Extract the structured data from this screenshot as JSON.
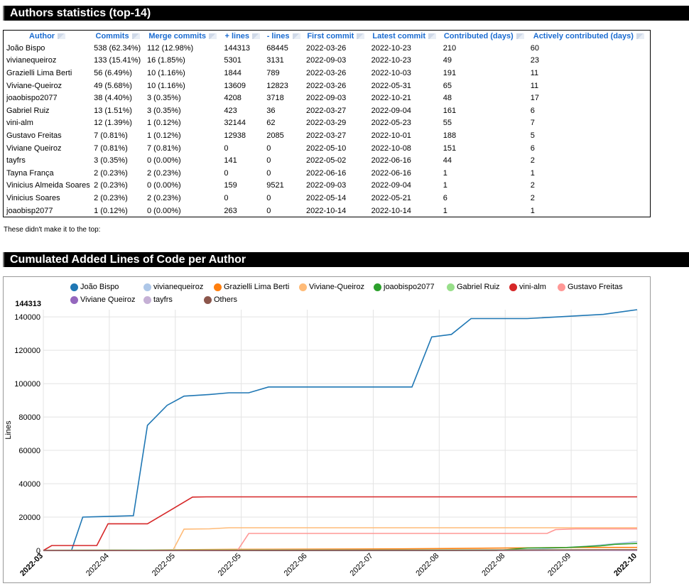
{
  "authors_section": {
    "title": "Authors statistics (top-14)"
  },
  "table": {
    "headers": [
      "Author",
      "Commits",
      "Merge commits",
      "+ lines",
      "- lines",
      "First commit",
      "Latest commit",
      "Contributed (days)",
      "Actively contributed (days)"
    ],
    "rows": [
      [
        "João Bispo",
        "538 (62.34%)",
        "112 (12.98%)",
        "144313",
        "68445",
        "2022-03-26",
        "2022-10-23",
        "210",
        "60"
      ],
      [
        "vivianequeiroz",
        "133 (15.41%)",
        "16 (1.85%)",
        "5301",
        "3131",
        "2022-09-03",
        "2022-10-23",
        "49",
        "23"
      ],
      [
        "Grazielli Lima Berti",
        "56 (6.49%)",
        "10 (1.16%)",
        "1844",
        "789",
        "2022-03-26",
        "2022-10-03",
        "191",
        "11"
      ],
      [
        "Viviane-Queiroz",
        "49 (5.68%)",
        "10 (1.16%)",
        "13609",
        "12823",
        "2022-03-26",
        "2022-05-31",
        "65",
        "11"
      ],
      [
        "joaobispo2077",
        "38 (4.40%)",
        "3 (0.35%)",
        "4208",
        "3718",
        "2022-09-03",
        "2022-10-21",
        "48",
        "17"
      ],
      [
        "Gabriel Ruiz",
        "13 (1.51%)",
        "3 (0.35%)",
        "423",
        "36",
        "2022-03-27",
        "2022-09-04",
        "161",
        "6"
      ],
      [
        "vini-alm",
        "12 (1.39%)",
        "1 (0.12%)",
        "32144",
        "62",
        "2022-03-29",
        "2022-05-23",
        "55",
        "7"
      ],
      [
        "Gustavo Freitas",
        "7 (0.81%)",
        "1 (0.12%)",
        "12938",
        "2085",
        "2022-03-27",
        "2022-10-01",
        "188",
        "5"
      ],
      [
        "Viviane Queiroz",
        "7 (0.81%)",
        "7 (0.81%)",
        "0",
        "0",
        "2022-05-10",
        "2022-10-08",
        "151",
        "6"
      ],
      [
        "tayfrs",
        "3 (0.35%)",
        "0 (0.00%)",
        "141",
        "0",
        "2022-05-02",
        "2022-06-16",
        "44",
        "2"
      ],
      [
        "Tayna França",
        "2 (0.23%)",
        "2 (0.23%)",
        "0",
        "0",
        "2022-06-16",
        "2022-06-16",
        "1",
        "1"
      ],
      [
        "Vinicius Almeida Soares",
        "2 (0.23%)",
        "0 (0.00%)",
        "159",
        "9521",
        "2022-09-03",
        "2022-09-04",
        "1",
        "2"
      ],
      [
        "Vinicius Soares",
        "2 (0.23%)",
        "2 (0.23%)",
        "0",
        "0",
        "2022-05-14",
        "2022-05-21",
        "6",
        "2"
      ],
      [
        "joaobisp2077",
        "1 (0.12%)",
        "0 (0.00%)",
        "263",
        "0",
        "2022-10-14",
        "2022-10-14",
        "1",
        "1"
      ]
    ]
  },
  "note": "These didn't make it to the top:",
  "chart_section": {
    "title": "Cumulated Added Lines of Code per Author"
  },
  "chart_data": {
    "type": "line",
    "title": "",
    "xlabel": "",
    "ylabel": "Lines",
    "ylim": [
      0,
      144313
    ],
    "y_ticks": [
      0,
      20000,
      40000,
      60000,
      80000,
      100000,
      120000,
      140000
    ],
    "y_max_label": "144313",
    "x_ticks": [
      "2022-03",
      "2022-04",
      "2022-05",
      "2022-05",
      "2022-06",
      "2022-07",
      "2022-08",
      "2022-08",
      "2022-09",
      "2022-10"
    ],
    "x_range": [
      "2022-03-26",
      "2022-10-23"
    ],
    "grid": true,
    "legend_position": "top",
    "series": [
      {
        "name": "João Bispo",
        "color": "#1f77b4",
        "points": [
          [
            "2022-03-26",
            0
          ],
          [
            "2022-04-05",
            0
          ],
          [
            "2022-04-09",
            20000
          ],
          [
            "2022-04-20",
            20500
          ],
          [
            "2022-04-27",
            20800
          ],
          [
            "2022-05-02",
            75000
          ],
          [
            "2022-05-09",
            87000
          ],
          [
            "2022-05-15",
            92500
          ],
          [
            "2022-05-24",
            93500
          ],
          [
            "2022-05-31",
            94500
          ],
          [
            "2022-06-07",
            94500
          ],
          [
            "2022-06-14",
            98000
          ],
          [
            "2022-08-04",
            98000
          ],
          [
            "2022-08-11",
            128000
          ],
          [
            "2022-08-18",
            129500
          ],
          [
            "2022-08-25",
            139000
          ],
          [
            "2022-09-14",
            139000
          ],
          [
            "2022-10-11",
            141500
          ],
          [
            "2022-10-23",
            144313
          ]
        ]
      },
      {
        "name": "vivianequeiroz",
        "color": "#aec7e8",
        "points": [
          [
            "2022-03-26",
            0
          ],
          [
            "2022-09-03",
            0
          ],
          [
            "2022-09-18",
            800
          ],
          [
            "2022-10-05",
            2500
          ],
          [
            "2022-10-23",
            5301
          ]
        ]
      },
      {
        "name": "Grazielli Lima Berti",
        "color": "#ff7f0e",
        "points": [
          [
            "2022-03-26",
            0
          ],
          [
            "2022-05-01",
            300
          ],
          [
            "2022-06-01",
            700
          ],
          [
            "2022-08-01",
            1000
          ],
          [
            "2022-09-01",
            1400
          ],
          [
            "2022-10-03",
            1844
          ],
          [
            "2022-10-23",
            1844
          ]
        ]
      },
      {
        "name": "Viviane-Queiroz",
        "color": "#ffbb78",
        "points": [
          [
            "2022-03-26",
            0
          ],
          [
            "2022-05-11",
            0
          ],
          [
            "2022-05-15",
            12800
          ],
          [
            "2022-05-24",
            13000
          ],
          [
            "2022-05-31",
            13609
          ],
          [
            "2022-10-23",
            13609
          ]
        ]
      },
      {
        "name": "joaobispo2077",
        "color": "#2ca02c",
        "points": [
          [
            "2022-03-26",
            0
          ],
          [
            "2022-09-03",
            0
          ],
          [
            "2022-09-14",
            1500
          ],
          [
            "2022-09-28",
            1800
          ],
          [
            "2022-10-10",
            2800
          ],
          [
            "2022-10-15",
            3700
          ],
          [
            "2022-10-23",
            4208
          ]
        ]
      },
      {
        "name": "Gabriel Ruiz",
        "color": "#98df8a",
        "points": [
          [
            "2022-03-26",
            0
          ],
          [
            "2022-03-27",
            200
          ],
          [
            "2022-05-01",
            300
          ],
          [
            "2022-09-04",
            423
          ],
          [
            "2022-10-23",
            423
          ]
        ]
      },
      {
        "name": "vini-alm",
        "color": "#d62728",
        "points": [
          [
            "2022-03-26",
            0
          ],
          [
            "2022-03-29",
            3000
          ],
          [
            "2022-04-14",
            3000
          ],
          [
            "2022-04-18",
            16000
          ],
          [
            "2022-05-02",
            16000
          ],
          [
            "2022-05-11",
            25000
          ],
          [
            "2022-05-18",
            32000
          ],
          [
            "2022-05-23",
            32144
          ],
          [
            "2022-10-23",
            32144
          ]
        ]
      },
      {
        "name": "Gustavo Freitas",
        "color": "#ff9896",
        "points": [
          [
            "2022-03-26",
            0
          ],
          [
            "2022-06-03",
            0
          ],
          [
            "2022-06-07",
            10200
          ],
          [
            "2022-09-21",
            10200
          ],
          [
            "2022-09-24",
            12500
          ],
          [
            "2022-10-01",
            12938
          ],
          [
            "2022-10-23",
            12938
          ]
        ]
      },
      {
        "name": "Viviane Queiroz",
        "color": "#9467bd",
        "points": [
          [
            "2022-03-26",
            0
          ],
          [
            "2022-10-23",
            0
          ]
        ]
      },
      {
        "name": "tayfrs",
        "color": "#c5b0d5",
        "points": [
          [
            "2022-03-26",
            0
          ],
          [
            "2022-05-02",
            0
          ],
          [
            "2022-06-16",
            141
          ],
          [
            "2022-10-23",
            141
          ]
        ]
      },
      {
        "name": "Others",
        "color": "#8c564b",
        "points": [
          [
            "2022-03-26",
            0
          ],
          [
            "2022-09-03",
            159
          ],
          [
            "2022-10-14",
            422
          ],
          [
            "2022-10-23",
            422
          ]
        ]
      }
    ]
  }
}
